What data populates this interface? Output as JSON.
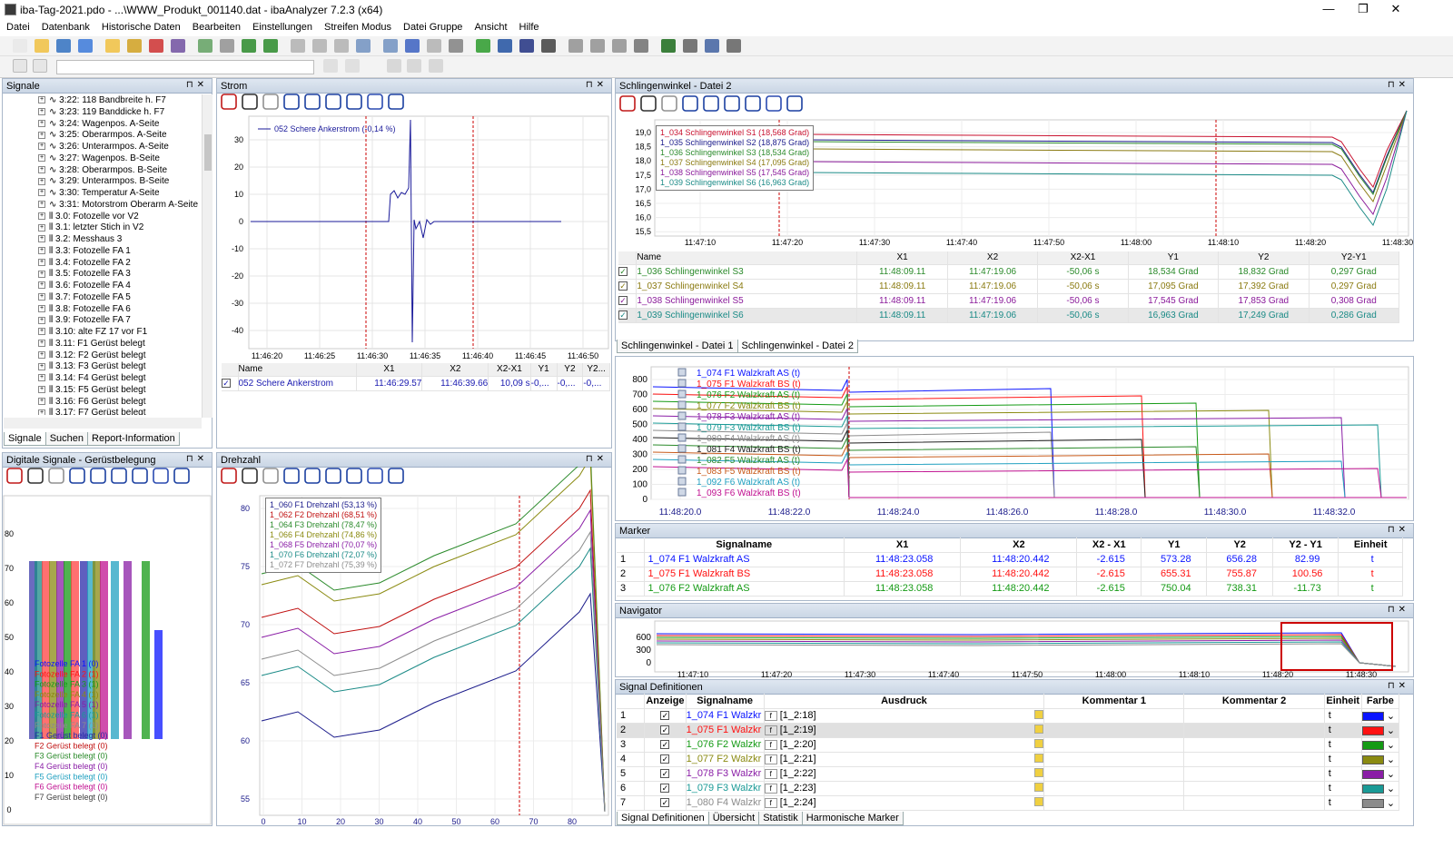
{
  "window": {
    "title": "iba-Tag-2021.pdo - ...\\WWW_Produkt_001140.dat - ibaAnalyzer 7.2.3 (x64)",
    "min": "—",
    "max": "❐",
    "close": "✕"
  },
  "menu": [
    "Datei",
    "Datenbank",
    "Historische Daten",
    "Bearbeiten",
    "Einstellungen",
    "Streifen Modus",
    "Datei Gruppe",
    "Ansicht",
    "Hilfe"
  ],
  "signals": {
    "title": "Signale",
    "items": [
      "3:22: 118 Bandbreite h. F7",
      "3:23: 119 Banddicke h. F7",
      "3:24: Wagenpos. A-Seite",
      "3:25: Oberarmpos. A-Seite",
      "3:26: Unterarmpos. A-Seite",
      "3:27: Wagenpos. B-Seite",
      "3:28: Oberarmpos. B-Seite",
      "3:29: Unterarmpos. B-Seite",
      "3:30: Temperatur A-Seite",
      "3:31: Motorstrom Oberarm A-Seite",
      "3.0: Fotozelle vor V2",
      "3.1: letzter Stich in V2",
      "3.2: Messhaus 3",
      "3.3: Fotozelle FA 1",
      "3.4: Fotozelle FA 2",
      "3.5: Fotozelle FA 3",
      "3.6: Fotozelle FA 4",
      "3.7: Fotozelle FA 5",
      "3.8: Fotozelle FA 6",
      "3.9: Fotozelle FA 7",
      "3.10: alte FZ 17 vor F1",
      "3.11: F1 Gerüst belegt",
      "3.12: F2 Gerüst belegt",
      "3.13: F3 Gerüst belegt",
      "3.14: F4 Gerüst belegt",
      "3.15: F5 Gerüst belegt",
      "3.16: F6 Gerüst belegt",
      "3.17: F7 Gerüst belegt"
    ],
    "tabs": [
      "Signale",
      "Suchen",
      "Report-Information"
    ]
  },
  "strom": {
    "title": "Strom",
    "legend": "052 Schere Ankerstrom (-0,14 %)",
    "yticks": [
      "30",
      "20",
      "10",
      "0",
      "-10",
      "-20",
      "-30",
      "-40"
    ],
    "xticks": [
      "11:46:20",
      "11:46:25",
      "11:46:30",
      "11:46:35",
      "11:46:40",
      "11:46:45",
      "11:46:50"
    ],
    "table": {
      "headers": [
        "Name",
        "X1",
        "X2",
        "X2-X1",
        "Y1",
        "Y2",
        "Y2..."
      ],
      "row": [
        "052 Schere Ankerstrom",
        "11:46:29.57",
        "11:46:39.66",
        "10,09 s",
        "-0,...",
        "-0,...",
        "-0,..."
      ]
    }
  },
  "schling": {
    "title": "Schlingenwinkel - Datei 2",
    "legend": [
      "1_034 Schlingenwinkel S1 (18,568 Grad)",
      "1_035 Schlingenwinkel S2 (18,875 Grad)",
      "1_036 Schlingenwinkel S3 (18,534 Grad)",
      "1_037 Schlingenwinkel S4 (17,095 Grad)",
      "1_038 Schlingenwinkel S5 (17,545 Grad)",
      "1_039 Schlingenwinkel S6 (16,963 Grad)"
    ],
    "yticks": [
      "19,0",
      "18,5",
      "18,0",
      "17,5",
      "17,0",
      "16,5",
      "16,0",
      "15,5"
    ],
    "xticks": [
      "11:47:10",
      "11:47:20",
      "11:47:30",
      "11:47:40",
      "11:47:50",
      "11:48:00",
      "11:48:10",
      "11:48:20",
      "11:48:30"
    ],
    "table": {
      "headers": [
        "Name",
        "X1",
        "X2",
        "X2-X1",
        "Y1",
        "Y2",
        "Y2-Y1"
      ],
      "rows": [
        [
          "1_036 Schlingenwinkel S3",
          "11:48:09.11",
          "11:47:19.06",
          "-50,06 s",
          "18,534 Grad",
          "18,832 Grad",
          "0,297 Grad"
        ],
        [
          "1_037 Schlingenwinkel S4",
          "11:48:09.11",
          "11:47:19.06",
          "-50,06 s",
          "17,095 Grad",
          "17,392 Grad",
          "0,297 Grad"
        ],
        [
          "1_038 Schlingenwinkel S5",
          "11:48:09.11",
          "11:47:19.06",
          "-50,06 s",
          "17,545 Grad",
          "17,853 Grad",
          "0,308 Grad"
        ],
        [
          "1_039 Schlingenwinkel S6",
          "11:48:09.11",
          "11:47:19.06",
          "-50,06 s",
          "16,963 Grad",
          "17,249 Grad",
          "0,286 Grad"
        ]
      ]
    },
    "tabs": [
      "Schlingenwinkel - Datei 1",
      "Schlingenwinkel - Datei 2"
    ]
  },
  "walz": {
    "legend": [
      "1_074 F1 Walzkraft AS (t)",
      "1_075 F1 Walzkraft BS (t)",
      "1_076 F2 Walzkraft AS (t)",
      "1_077 F2 Walzkraft BS (t)",
      "1_078 F3 Walzkraft AS (t)",
      "1_079 F3 Walzkraft BS (t)",
      "1_080 F4 Walzkraft AS (t)",
      "1_081 F4 Walzkraft BS (t)",
      "1_082 F5 Walzkraft AS (t)",
      "1_083 F5 Walzkraft BS (t)",
      "1_092 F6 Walzkraft AS (t)",
      "1_093 F6 Walzkraft BS (t)"
    ],
    "yticks": [
      "800",
      "700",
      "600",
      "500",
      "400",
      "300",
      "200",
      "100",
      "0"
    ],
    "xticks": [
      "11:48:20.0",
      "11:48:22.0",
      "11:48:24.0",
      "11:48:26.0",
      "11:48:28.0",
      "11:48:30.0",
      "11:48:32.0"
    ]
  },
  "marker": {
    "title": "Marker",
    "headers": [
      "Signalname",
      "X1",
      "X2",
      "X2 - X1",
      "Y1",
      "Y2",
      "Y2 - Y1",
      "Einheit"
    ],
    "rows": [
      [
        "1",
        "1_074 F1 Walzkraft AS",
        "11:48:23.058",
        "11:48:20.442",
        "-2.615",
        "573.28",
        "656.28",
        "82.99",
        "t"
      ],
      [
        "2",
        "1_075 F1 Walzkraft BS",
        "11:48:23.058",
        "11:48:20.442",
        "-2.615",
        "655.31",
        "755.87",
        "100.56",
        "t"
      ],
      [
        "3",
        "1_076 F2 Walzkraft AS",
        "11:48:23.058",
        "11:48:20.442",
        "-2.615",
        "750.04",
        "738.31",
        "-11.73",
        "t"
      ]
    ]
  },
  "navigator": {
    "title": "Navigator",
    "yticks": [
      "600",
      "300",
      "0"
    ],
    "xticks": [
      "11:47:10",
      "11:47:20",
      "11:47:30",
      "11:47:40",
      "11:47:50",
      "11:48:00",
      "11:48:10",
      "11:48:20",
      "11:48:30"
    ]
  },
  "sigdef": {
    "title": "Signal Definitionen",
    "headers": [
      "Anzeige",
      "Signalname",
      "Ausdruck",
      "Kommentar 1",
      "Kommentar 2",
      "Einheit",
      "Farbe"
    ],
    "rows": [
      [
        "1",
        "1_074 F1 Walzkr",
        "[1_2:18]",
        "t",
        "#0a14ff"
      ],
      [
        "2",
        "1_075 F1 Walzkr",
        "[1_2:19]",
        "t",
        "#ff1212"
      ],
      [
        "3",
        "1_076 F2 Walzkr",
        "[1_2:20]",
        "t",
        "#149a14"
      ],
      [
        "4",
        "1_077 F2 Walzkr",
        "[1_2:21]",
        "t",
        "#8a8a10"
      ],
      [
        "5",
        "1_078 F3 Walzkr",
        "[1_2:22]",
        "t",
        "#8a1ea6"
      ],
      [
        "6",
        "1_079 F3 Walzkr",
        "[1_2:23]",
        "t",
        "#1a9a96"
      ],
      [
        "7",
        "1_080 F4 Walzkr",
        "[1_2:24]",
        "t",
        "#8c8c8c"
      ]
    ],
    "tabs": [
      "Signal Definitionen",
      "Übersicht",
      "Statistik",
      "Harmonische Marker"
    ]
  },
  "digital": {
    "title": "Digitale Signale - Gerüstbelegung",
    "yticks": [
      "80",
      "70",
      "60",
      "50",
      "40",
      "30",
      "20",
      "10",
      "0"
    ],
    "labels": [
      "Fotozelle FA 1 (0)",
      "Fotozelle FA 2 (1)",
      "Fotozelle FA 3 (1)",
      "Fotozelle FA 4 (1)",
      "Fotozelle FA 5 (1)",
      "Fotozelle FA 6 (1)",
      "Fotozelle FA 7 (1)",
      "F1 Gerüst belegt (0)",
      "F2 Gerüst belegt (0)",
      "F3 Gerüst belegt (0)",
      "F4 Gerüst belegt (0)",
      "F5 Gerüst belegt (0)",
      "F6 Gerüst belegt (0)",
      "F7 Gerüst belegt (0)"
    ]
  },
  "drehzahl": {
    "title": "Drehzahl",
    "legend": [
      "1_060 F1 Drehzahl (53,13 %)",
      "1_062 F2 Drehzahl (68,51 %)",
      "1_064 F3 Drehzahl (78,47 %)",
      "1_066 F4 Drehzahl (74,86 %)",
      "1_068 F5 Drehzahl (70,07 %)",
      "1_070 F6 Drehzahl (72,07 %)",
      "1_072 F7 Drehzahl (75,39 %)"
    ],
    "yticks": [
      "80",
      "75",
      "70",
      "65",
      "60",
      "55"
    ],
    "xticks": [
      "0",
      "10",
      "20",
      "30",
      "40",
      "50",
      "60",
      "70",
      "80"
    ]
  },
  "colors": {
    "accent": "#a9b7c9",
    "cursor": "#cc0000"
  }
}
